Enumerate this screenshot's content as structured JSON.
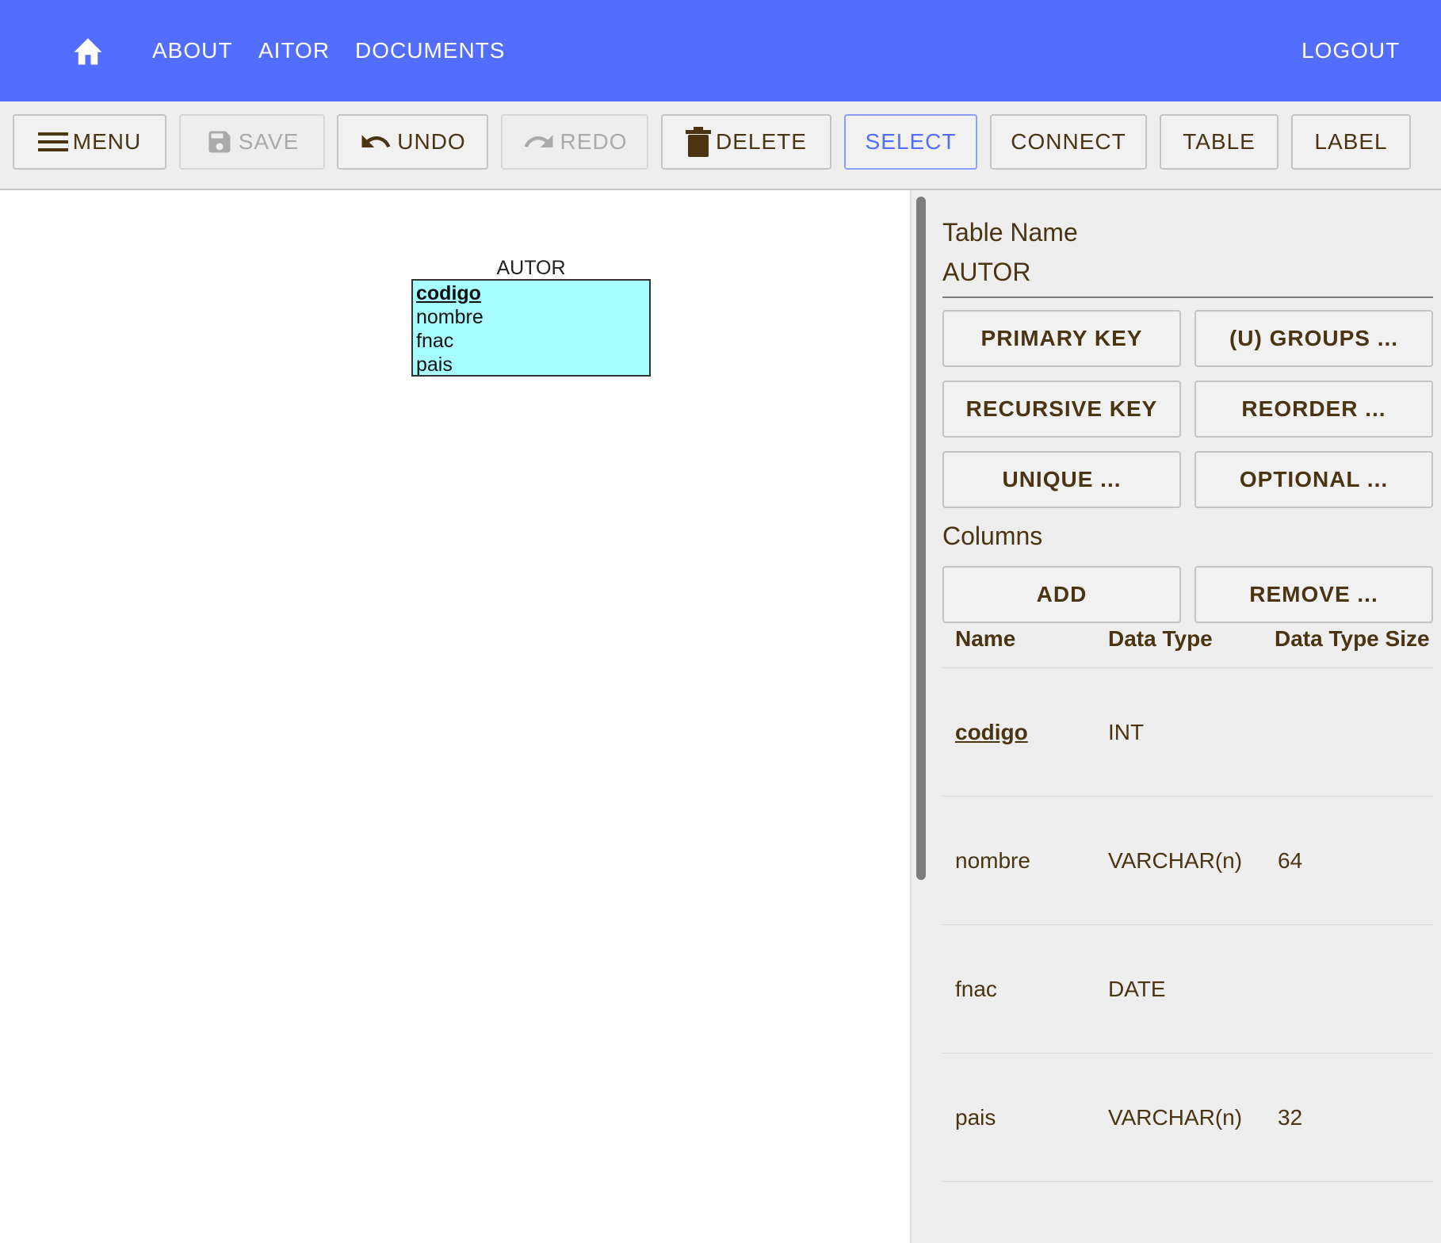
{
  "nav": {
    "home_icon": "home-icon",
    "about": "ABOUT",
    "user": "AITOR",
    "documents": "DOCUMENTS",
    "logout": "LOGOUT"
  },
  "toolbar": {
    "menu": "MENU",
    "save": "SAVE",
    "undo": "UNDO",
    "redo": "REDO",
    "delete": "DELETE",
    "select": "SELECT",
    "connect": "CONNECT",
    "table": "TABLE",
    "label": "LABEL"
  },
  "diagram": {
    "entity": {
      "name": "AUTOR",
      "attributes": [
        {
          "name": "codigo",
          "primary": true
        },
        {
          "name": "nombre",
          "primary": false
        },
        {
          "name": "fnac",
          "primary": false
        },
        {
          "name": "pais",
          "primary": false
        }
      ]
    }
  },
  "panel": {
    "table_name_label": "Table Name",
    "table_name_value": "AUTOR",
    "buttons": {
      "primary_key": "PRIMARY KEY",
      "u_groups": "(U) GROUPS ...",
      "recursive_key": "RECURSIVE KEY",
      "reorder": "REORDER ...",
      "unique": "UNIQUE ...",
      "optional": "OPTIONAL ..."
    },
    "columns_label": "Columns",
    "add": "ADD",
    "remove": "REMOVE ...",
    "headers": {
      "name": "Name",
      "data_type": "Data Type",
      "data_type_size": "Data Type Size"
    },
    "rows": [
      {
        "name": "codigo",
        "type": "INT",
        "size": "",
        "primary": true
      },
      {
        "name": "nombre",
        "type": "VARCHAR(n)",
        "size": "64",
        "primary": false
      },
      {
        "name": "fnac",
        "type": "DATE",
        "size": "",
        "primary": false
      },
      {
        "name": "pais",
        "type": "VARCHAR(n)",
        "size": "32",
        "primary": false
      }
    ]
  },
  "colors": {
    "appbar": "#536dfe",
    "entity_fill": "#a6fcff",
    "text": "#4a3412",
    "panel_bg": "#eeeeee"
  }
}
